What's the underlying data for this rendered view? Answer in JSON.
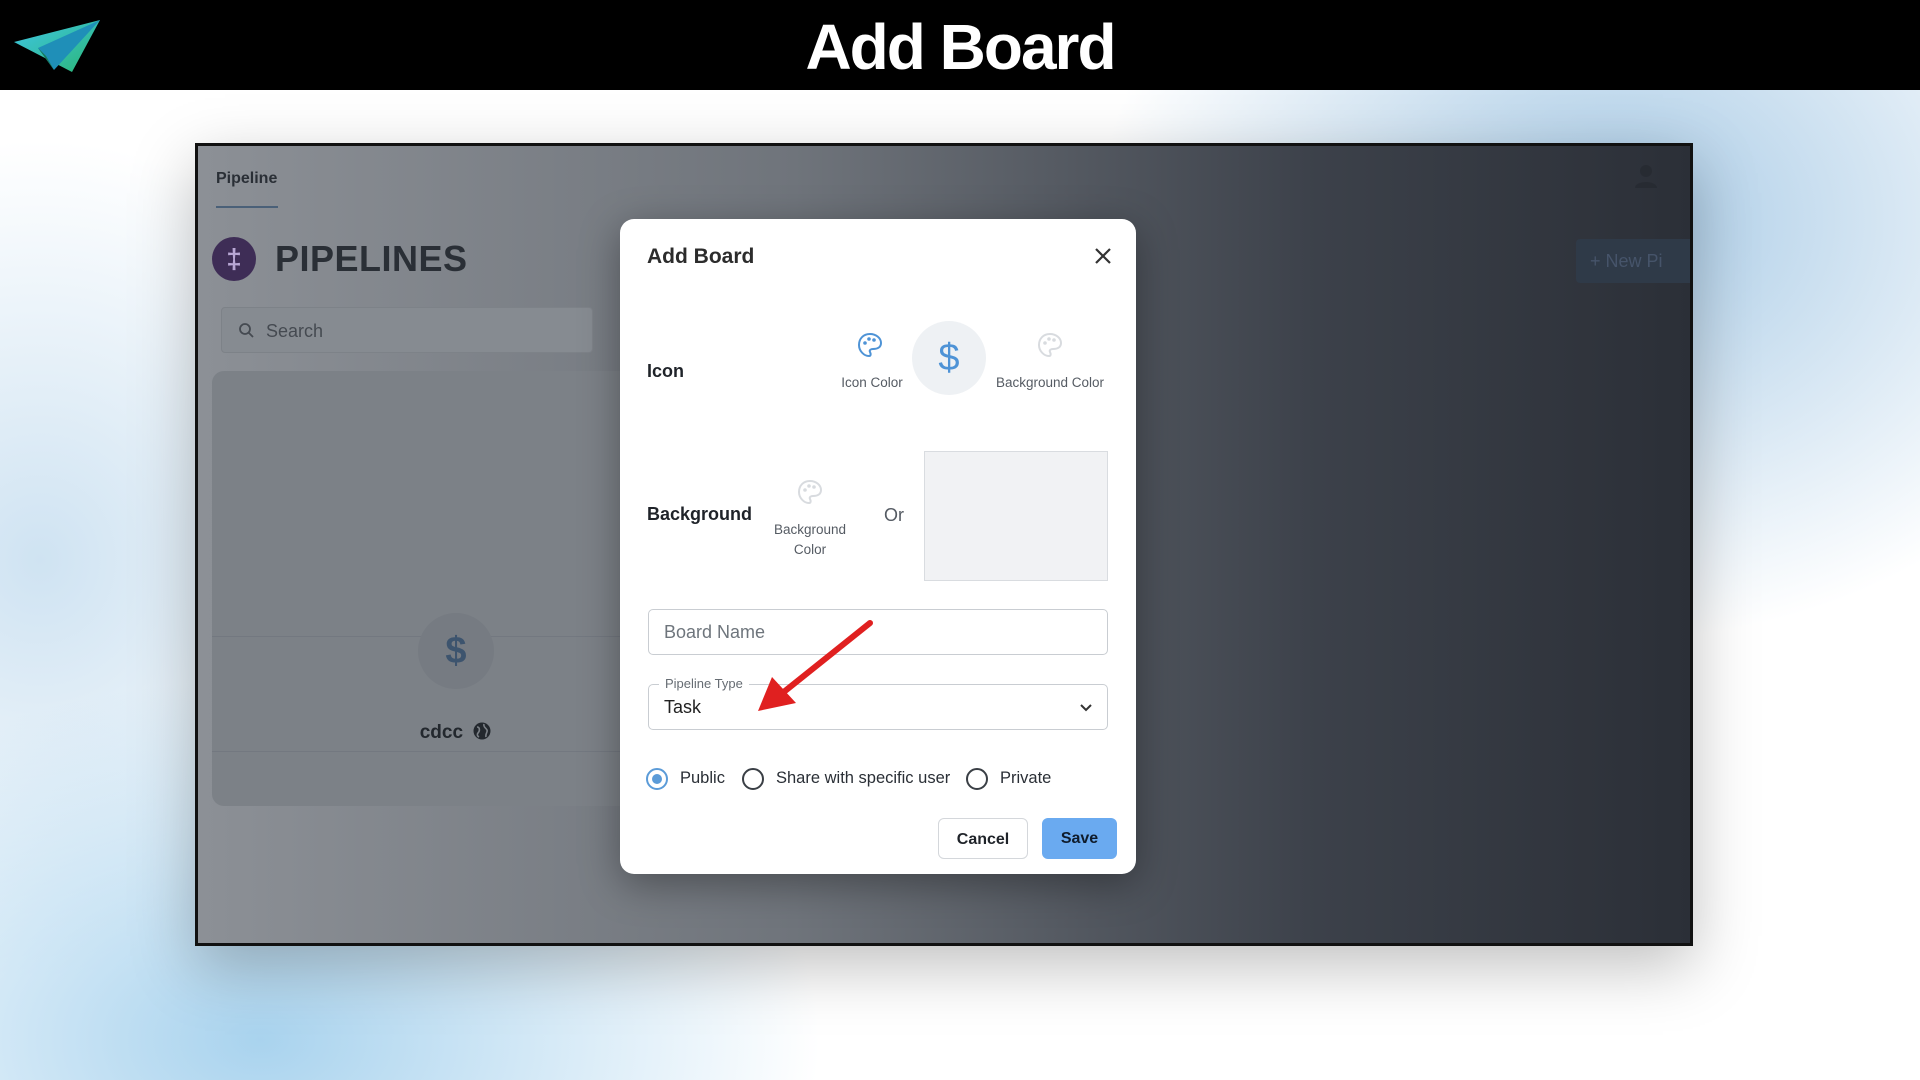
{
  "header": {
    "title": "Add Board"
  },
  "app": {
    "tab_label": "Pipeline",
    "page_title": "PIPELINES",
    "search_placeholder": "Search",
    "card": {
      "name": "cdcc",
      "icon_symbol": "$"
    },
    "new_button_label": "+ New Pi"
  },
  "modal": {
    "title": "Add Board",
    "icon_label": "Icon",
    "icon_color_label": "Icon Color",
    "icon_symbol": "$",
    "icon_bg_color_label": "Background Color",
    "background_label": "Background",
    "background_color_label_line1": "Background",
    "background_color_label_line2": "Color",
    "or_label": "Or",
    "board_name_placeholder": "Board Name",
    "pipeline_type_label": "Pipeline Type",
    "pipeline_type_value": "Task",
    "visibility": {
      "options": [
        "Public",
        "Share with specific user",
        "Private"
      ],
      "selected": "Public"
    },
    "cancel_label": "Cancel",
    "save_label": "Save"
  },
  "colors": {
    "accent": "#6aaaf0",
    "radio_selected": "#5b9bd8",
    "arrow": "#e02020"
  }
}
